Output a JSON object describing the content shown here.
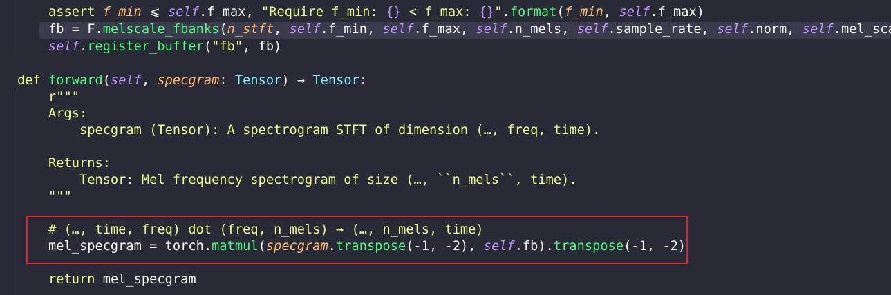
{
  "editor": {
    "language": "python",
    "lines": [
      [
        [
          "    assert ",
          "kw"
        ],
        [
          "f_min",
          "param"
        ],
        [
          " ⩽ ",
          "op"
        ],
        [
          "self",
          "self"
        ],
        [
          ".f_max, ",
          "op"
        ],
        [
          "\"Require f_min: ",
          "str"
        ],
        [
          "{}",
          "fmt"
        ],
        [
          " < f_max: ",
          "str"
        ],
        [
          "{}",
          "fmt"
        ],
        [
          "\"",
          "str"
        ],
        [
          ".",
          "op"
        ],
        [
          "format",
          "fn"
        ],
        [
          "(",
          "op"
        ],
        [
          "f_min",
          "param"
        ],
        [
          ", ",
          "op"
        ],
        [
          "self",
          "self"
        ],
        [
          ".f_max)",
          "op"
        ]
      ],
      [
        [
          "    fb = F.",
          "op"
        ],
        [
          "melscale_fbanks",
          "fn"
        ],
        [
          "(",
          "op"
        ],
        [
          "n_stft",
          "param"
        ],
        [
          ", ",
          "op"
        ],
        [
          "self",
          "self"
        ],
        [
          ".f_min, ",
          "op"
        ],
        [
          "self",
          "self"
        ],
        [
          ".f_max, ",
          "op"
        ],
        [
          "self",
          "self"
        ],
        [
          ".n_mels, ",
          "op"
        ],
        [
          "self",
          "self"
        ],
        [
          ".sample_rate, ",
          "op"
        ],
        [
          "self",
          "self"
        ],
        [
          ".norm, ",
          "op"
        ],
        [
          "self",
          "self"
        ],
        [
          ".mel_scale)",
          "op"
        ]
      ],
      [
        [
          "    ",
          "op"
        ],
        [
          "self",
          "self"
        ],
        [
          ".",
          "op"
        ],
        [
          "register_buffer",
          "fn"
        ],
        [
          "(",
          "op"
        ],
        [
          "\"fb\"",
          "str"
        ],
        [
          ", fb)",
          "op"
        ]
      ],
      [],
      [
        [
          "def ",
          "kw"
        ],
        [
          "forward",
          "fn"
        ],
        [
          "(",
          "op"
        ],
        [
          "self",
          "self"
        ],
        [
          ", ",
          "op"
        ],
        [
          "specgram",
          "param"
        ],
        [
          ": ",
          "op"
        ],
        [
          "Tensor",
          "type"
        ],
        [
          ") → ",
          "op"
        ],
        [
          "Tensor",
          "type"
        ],
        [
          ":",
          "op"
        ]
      ],
      [
        [
          "    r\"\"\"",
          "doc"
        ]
      ],
      [
        [
          "    Args:",
          "doc"
        ]
      ],
      [
        [
          "        specgram (Tensor): A spectrogram STFT of dimension (…, freq, time).",
          "doc"
        ]
      ],
      [],
      [
        [
          "    Returns:",
          "doc"
        ]
      ],
      [
        [
          "        Tensor: Mel frequency spectrogram of size (…, ``n_mels``, time).",
          "doc"
        ]
      ],
      [
        [
          "    \"\"\"",
          "doc"
        ]
      ],
      [],
      [
        [
          "    # (…, time, freq) dot (freq, n_mels) → (…, n_mels, time)",
          "cm"
        ]
      ],
      [
        [
          "    mel_specgram = torch.",
          "op"
        ],
        [
          "matmul",
          "fn"
        ],
        [
          "(",
          "op"
        ],
        [
          "specgram",
          "param"
        ],
        [
          ".",
          "op"
        ],
        [
          "transpose",
          "fn"
        ],
        [
          "(-1, -2), ",
          "op"
        ],
        [
          "self",
          "self"
        ],
        [
          ".fb).",
          "op"
        ],
        [
          "transpose",
          "fn"
        ],
        [
          "(-1, -2)",
          "op"
        ]
      ],
      [],
      [
        [
          "    ",
          "op"
        ],
        [
          "return",
          "kw"
        ],
        [
          " mel_specgram",
          "op"
        ]
      ]
    ],
    "highlighted_line": 1,
    "annotation_box_color": "#e5202a"
  }
}
